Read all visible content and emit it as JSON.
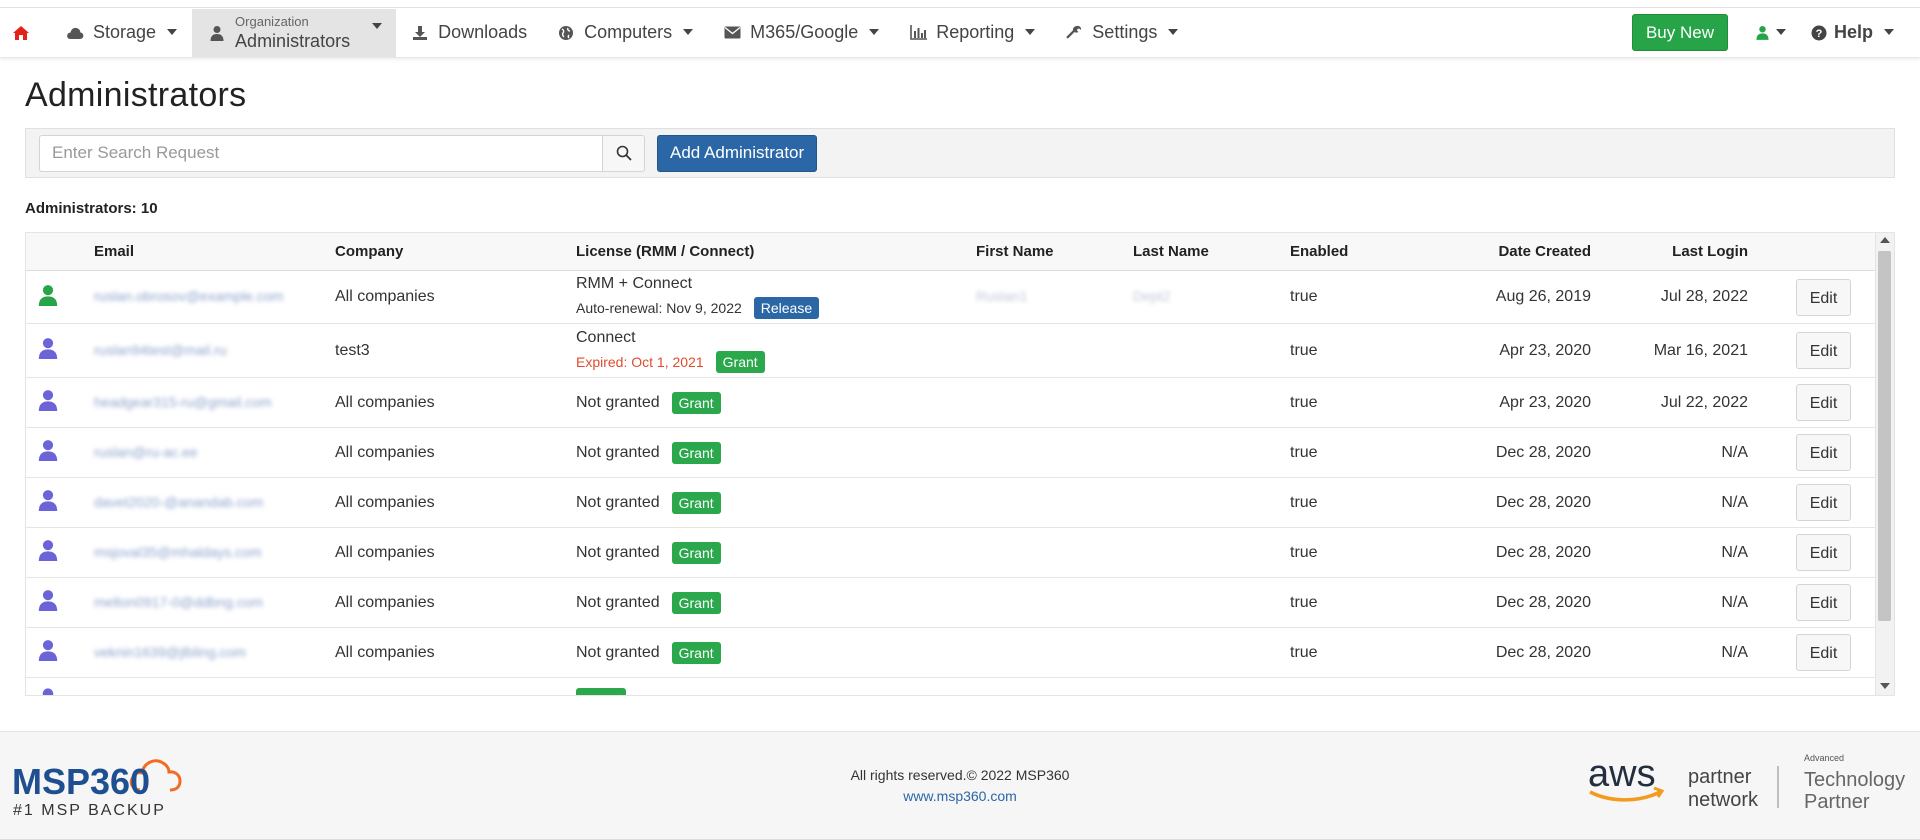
{
  "nav": {
    "storage": "Storage",
    "org_small": "Organization",
    "org_big": "Administrators",
    "downloads": "Downloads",
    "computers": "Computers",
    "m365": "M365/Google",
    "reporting": "Reporting",
    "settings": "Settings",
    "buy_new": "Buy New",
    "help": "Help"
  },
  "page": {
    "title": "Administrators",
    "search_placeholder": "Enter Search Request",
    "add_button": "Add Administrator",
    "count_label": "Administrators: 10"
  },
  "table": {
    "headers": {
      "email": "Email",
      "company": "Company",
      "license": "License (RMM / Connect)",
      "first": "First Name",
      "last": "Last Name",
      "enabled": "Enabled",
      "date": "Date Created",
      "login": "Last Login"
    },
    "edit_label": "Edit",
    "rows": [
      {
        "email": "ruslan.obrosov@example.com",
        "company": "All companies",
        "license_main": "RMM + Connect",
        "license_sub": "Auto-renewal:  Nov 9, 2022",
        "badge": "Release",
        "first": "Ruslan1",
        "last": "Dept2",
        "enabled": "true",
        "date": "Aug 26, 2019",
        "login": "Jul 28, 2022"
      },
      {
        "email": "ruslan94test@mail.ru",
        "company": "test3",
        "license_main": "Connect",
        "license_sub": "Expired: Oct 1, 2021",
        "badge": "Grant",
        "first": "",
        "last": "",
        "enabled": "true",
        "date": "Apr 23, 2020",
        "login": "Mar 16, 2021"
      },
      {
        "email": "headgear315-ru@gmail.com",
        "company": "All companies",
        "license_main": "Not granted",
        "license_sub": "",
        "badge": "Grant",
        "first": "",
        "last": "",
        "enabled": "true",
        "date": "Apr 23, 2020",
        "login": "Jul 22, 2022"
      },
      {
        "email": "ruslan@ru-ac.ee",
        "company": "All companies",
        "license_main": "Not granted",
        "license_sub": "",
        "badge": "Grant",
        "first": "",
        "last": "",
        "enabled": "true",
        "date": "Dec 28, 2020",
        "login": "N/A"
      },
      {
        "email": "davet2020-@anandab.com",
        "company": "All companies",
        "license_main": "Not granted",
        "license_sub": "",
        "badge": "Grant",
        "first": "",
        "last": "",
        "enabled": "true",
        "date": "Dec 28, 2020",
        "login": "N/A"
      },
      {
        "email": "msjoval35@mhaldays.com",
        "company": "All companies",
        "license_main": "Not granted",
        "license_sub": "",
        "badge": "Grant",
        "first": "",
        "last": "",
        "enabled": "true",
        "date": "Dec 28, 2020",
        "login": "N/A"
      },
      {
        "email": "melton0917-0@ddbng.com",
        "company": "All companies",
        "license_main": "Not granted",
        "license_sub": "",
        "badge": "Grant",
        "first": "",
        "last": "",
        "enabled": "true",
        "date": "Dec 28, 2020",
        "login": "N/A"
      },
      {
        "email": "veknin1639@jlbling.com",
        "company": "All companies",
        "license_main": "Not granted",
        "license_sub": "",
        "badge": "Grant",
        "first": "",
        "last": "",
        "enabled": "true",
        "date": "Dec 28, 2020",
        "login": "N/A"
      }
    ]
  },
  "footer": {
    "logo_text": "MSP360",
    "tagline": "#1 MSP BACKUP",
    "copyright": "All rights reserved.© 2022 MSP360",
    "url": "www.msp360.com",
    "aws": "aws",
    "partner": "partner",
    "network": "network",
    "advanced": "Advanced",
    "technology": "Technology",
    "partner2": "Partner"
  },
  "colors": {
    "accent_blue": "#2b67a6",
    "green": "#27a447",
    "home_red": "#e2231a",
    "user_purple": "#6c63d9",
    "user_green": "#27a447",
    "expired_red": "#e04b2e",
    "msp_blue": "#1d4f91",
    "msp_orange": "#f26b21"
  }
}
